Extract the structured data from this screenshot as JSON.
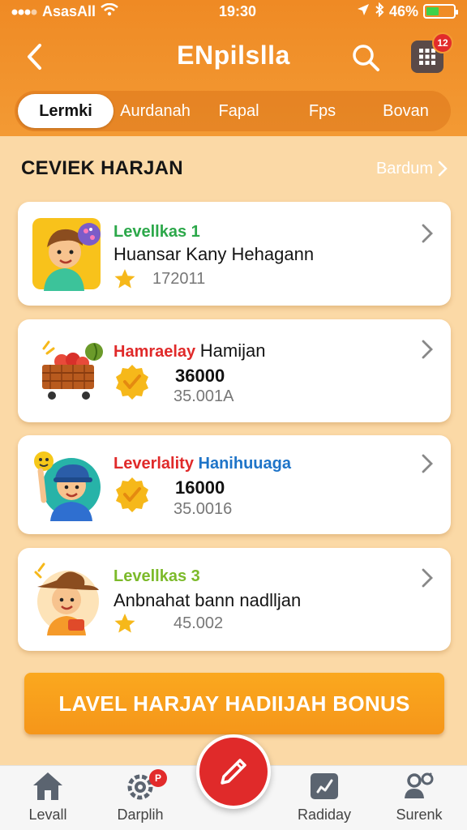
{
  "status_bar": {
    "carrier": "AsasAll",
    "time": "19:30",
    "battery": "46%",
    "battery_level": 0.46
  },
  "header": {
    "title": "ENpilslla",
    "notification_count": "12"
  },
  "tabs": [
    {
      "label": "Lermki",
      "active": true
    },
    {
      "label": "Aurdanah",
      "active": false
    },
    {
      "label": "Fapal",
      "active": false
    },
    {
      "label": "Fps",
      "active": false
    },
    {
      "label": "Bovan",
      "active": false
    }
  ],
  "section": {
    "title": "CEVIEK HARJAN",
    "see_all": "Bardum"
  },
  "cards": [
    {
      "line1": "Levellkas 1",
      "line1_color": "#2ca84a",
      "line2": "Huansar Kany Hehagann",
      "line3": "172011",
      "icon": "star-icon"
    },
    {
      "line1_a": "Hamraelay",
      "line1_b": "Hamijan",
      "line1_color": "#e02a2a",
      "big_number": "36000",
      "line3": "35.001A",
      "icon": "check-badge-icon"
    },
    {
      "line1_a": "Leverlality",
      "line1_b": "Hanihuuaga",
      "line1_color_a": "#e02a2a",
      "line1_color_b": "#1e74c8",
      "big_number": "16000",
      "line3": "35.0016",
      "icon": "check-badge-icon"
    },
    {
      "line1": "Levellkas 3",
      "line1_color": "#7cba2a",
      "line2": "Anbnahat bann nadlljan",
      "line3": "45.002",
      "icon": "star-icon"
    }
  ],
  "bonus_button": {
    "label": "LAVEL HARJAY HADIIJAH BONUS"
  },
  "bottom_nav": [
    {
      "label": "Levall",
      "icon": "home-icon"
    },
    {
      "label": "Darplih",
      "icon": "gear-icon",
      "badge": "P"
    },
    {
      "label": "Radiday",
      "icon": "edit-icon"
    },
    {
      "label": "Surenk",
      "icon": "users-icon"
    }
  ],
  "colors": {
    "brand_orange": "#ef8a24",
    "background": "#fbd9a6",
    "accent_red": "#e02a2a",
    "star_gold": "#f6b81a"
  }
}
